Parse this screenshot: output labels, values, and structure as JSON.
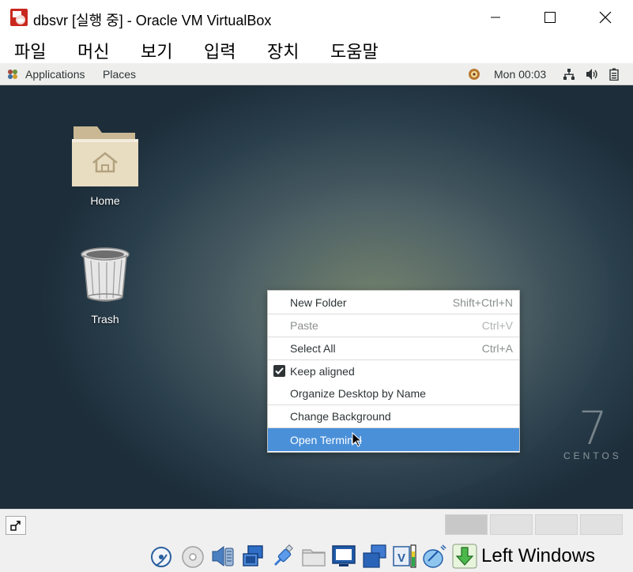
{
  "window": {
    "title": "dbsvr [실행 중] - Oracle VM VirtualBox",
    "minimize": "–",
    "maximize": "□",
    "close": "✕"
  },
  "menu": [
    "파일",
    "머신",
    "보기",
    "입력",
    "장치",
    "도움말"
  ],
  "gnome_panel": {
    "applications": "Applications",
    "places": "Places",
    "clock": "Mon 00:03",
    "icons": [
      "updates-icon",
      "network-icon",
      "volume-icon",
      "battery-icon"
    ]
  },
  "desktop": {
    "icons": [
      {
        "label": "Home",
        "icon": "home-folder-icon"
      },
      {
        "label": "Trash",
        "icon": "trash-icon"
      }
    ],
    "watermark": {
      "number": "7",
      "word": "CENTOS"
    }
  },
  "context_menu": {
    "items": [
      {
        "label": "New Folder",
        "shortcut": "Shift+Ctrl+N",
        "disabled": false
      },
      {
        "label": "Paste",
        "shortcut": "Ctrl+V",
        "disabled": true
      },
      {
        "label": "Select All",
        "shortcut": "Ctrl+A",
        "disabled": false
      },
      {
        "label": "Keep aligned",
        "shortcut": "",
        "checked": true
      },
      {
        "label": "Organize Desktop by Name",
        "shortcut": ""
      },
      {
        "label": "Change Background",
        "shortcut": ""
      },
      {
        "label": "Open Terminal",
        "shortcut": "",
        "highlighted": true
      }
    ]
  },
  "statusbar": {
    "host_key": "Left Windows",
    "icons": [
      "hard-disk-icon",
      "optical-drive-icon",
      "audio-icon",
      "network-adapters-icon",
      "usb-icon",
      "shared-folders-icon",
      "display-icon",
      "video-capture-icon",
      "vtx-cpu-icon",
      "mouse-integration-icon",
      "host-key-arrow-icon"
    ]
  },
  "colors": {
    "menu_highlight": "#4a90d9",
    "panel_bg": "#eeeeec",
    "title_icon_red": "#c8281e"
  }
}
